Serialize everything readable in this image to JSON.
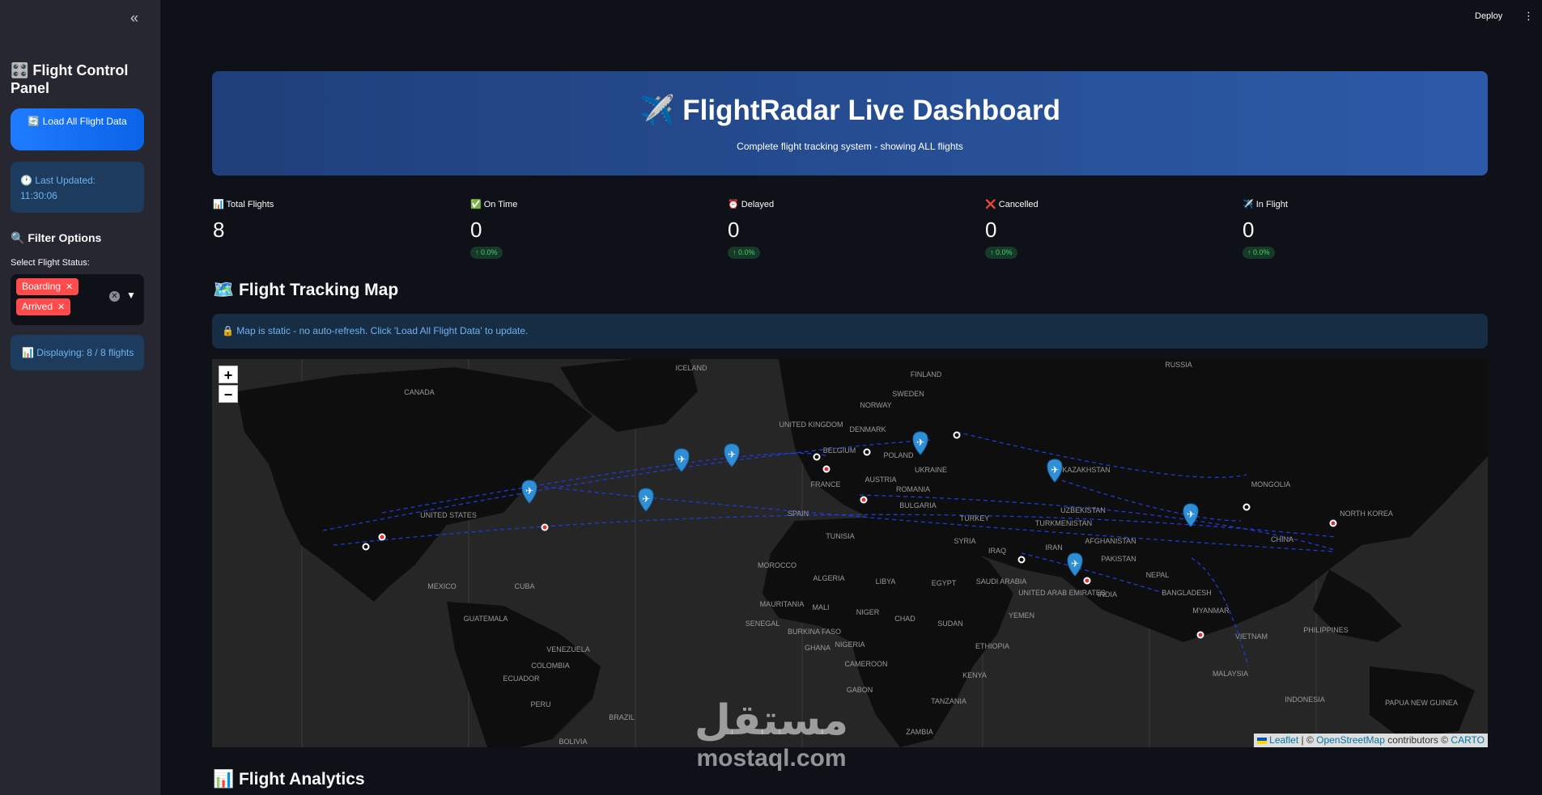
{
  "header": {
    "deploy_label": "Deploy",
    "menu_icon": "⋮"
  },
  "sidebar": {
    "collapse_icon": "«",
    "title": "🎛️ Flight Control Panel",
    "load_button": "🔄 Load All Flight Data",
    "last_updated": "🕐 Last Updated: 11:30:06",
    "filter_title": "🔍 Filter Options",
    "status_label": "Select Flight Status:",
    "selected_statuses": [
      "Boarding",
      "Arrived"
    ],
    "displaying": "📊 Displaying: 8 / 8 flights"
  },
  "hero": {
    "title": "✈️ FlightRadar Live Dashboard",
    "subtitle": "Complete flight tracking system - showing ALL flights"
  },
  "metrics": [
    {
      "label": "📊 Total Flights",
      "value": "8",
      "delta": ""
    },
    {
      "label": "✅ On Time",
      "value": "0",
      "delta": "↑ 0.0%"
    },
    {
      "label": "⏰ Delayed",
      "value": "0",
      "delta": "↑ 0.0%"
    },
    {
      "label": "❌ Cancelled",
      "value": "0",
      "delta": "↑ 0.0%"
    },
    {
      "label": "✈️ In Flight",
      "value": "0",
      "delta": "↑ 0.0%"
    }
  ],
  "map_section": {
    "title": "🗺️ Flight Tracking Map",
    "info": "🔒 Map is static - no auto-refresh. Click 'Load All Flight Data' to update.",
    "zoom_in": "+",
    "zoom_out": "−",
    "attribution": {
      "leaflet": "Leaflet",
      "sep": " | © ",
      "osm": "OpenStreetMap",
      "contributors": " contributors © ",
      "carto": "CARTO"
    },
    "labels": [
      "CANADA",
      "UNITED STATES",
      "MEXICO",
      "CUBA",
      "GUATEMALA",
      "VENEZUELA",
      "COLOMBIA",
      "ECUADOR",
      "PERU",
      "BRAZIL",
      "BOLIVIA",
      "ICELAND",
      "FINLAND",
      "SWEDEN",
      "NORWAY",
      "UNITED KINGDOM",
      "DENMARK",
      "POLAND",
      "BELGIUM",
      "FRANCE",
      "AUSTRIA",
      "ROMANIA",
      "BULGARIA",
      "UKRAINE",
      "SPAIN",
      "TUNISIA",
      "MOROCCO",
      "ALGERIA",
      "LIBYA",
      "EGYPT",
      "MAURITANIA",
      "MALI",
      "NIGER",
      "CHAD",
      "SUDAN",
      "SENEGAL",
      "BURKINA FASO",
      "GHANA",
      "NIGERIA",
      "ETHIOPIA",
      "CAMEROON",
      "GABON",
      "KENYA",
      "TANZANIA",
      "ZAMBIA",
      "TURKEY",
      "SYRIA",
      "IRAQ",
      "IRAN",
      "SAUDI ARABIA",
      "YEMEN",
      "UNITED ARAB EMIRATES",
      "KAZAKHSTAN",
      "UZBEKISTAN",
      "TURKMENISTAN",
      "AFGHANISTAN",
      "PAKISTAN",
      "INDIA",
      "NEPAL",
      "BANGLADESH",
      "MYANMAR",
      "VIETNAM",
      "PHILIPPINES",
      "MALAYSIA",
      "INDONESIA",
      "PAPUA NEW GUINEA",
      "MONGOLIA",
      "CHINA",
      "NORTH KOREA",
      "RUSSIA"
    ]
  },
  "analytics": {
    "title": "📊 Flight Analytics"
  },
  "watermark": {
    "arabic": "مستقل",
    "latin": "mostaql.com"
  }
}
